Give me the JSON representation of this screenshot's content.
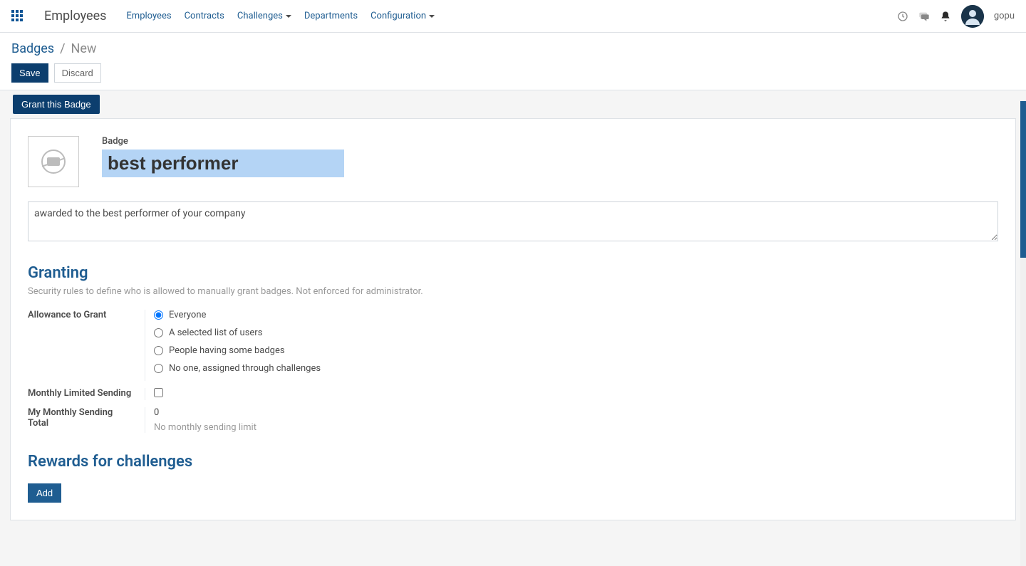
{
  "nav": {
    "app_title": "Employees",
    "items": [
      "Employees",
      "Contracts",
      "Challenges",
      "Departments",
      "Configuration"
    ],
    "dropdowns": [
      false,
      false,
      true,
      false,
      true
    ],
    "username": "gopu"
  },
  "breadcrumb": {
    "root": "Badges",
    "current": "New"
  },
  "buttons": {
    "save": "Save",
    "discard": "Discard",
    "grant": "Grant this Badge",
    "add": "Add"
  },
  "form": {
    "badge_label": "Badge",
    "badge_name": "best performer",
    "description": "awarded to the best performer of your company"
  },
  "granting": {
    "title": "Granting",
    "subtitle": "Security rules to define who is allowed to manually grant badges. Not enforced for administrator.",
    "allowance_label": "Allowance to Grant",
    "options": {
      "everyone": "Everyone",
      "selected": "A selected list of users",
      "badges": "People having some badges",
      "noone": "No one, assigned through challenges"
    },
    "monthly_limited_label": "Monthly Limited Sending",
    "monthly_total_label": "My Monthly Sending Total",
    "monthly_total_value": "0",
    "monthly_hint": "No monthly sending limit"
  },
  "rewards": {
    "title": "Rewards for challenges"
  }
}
